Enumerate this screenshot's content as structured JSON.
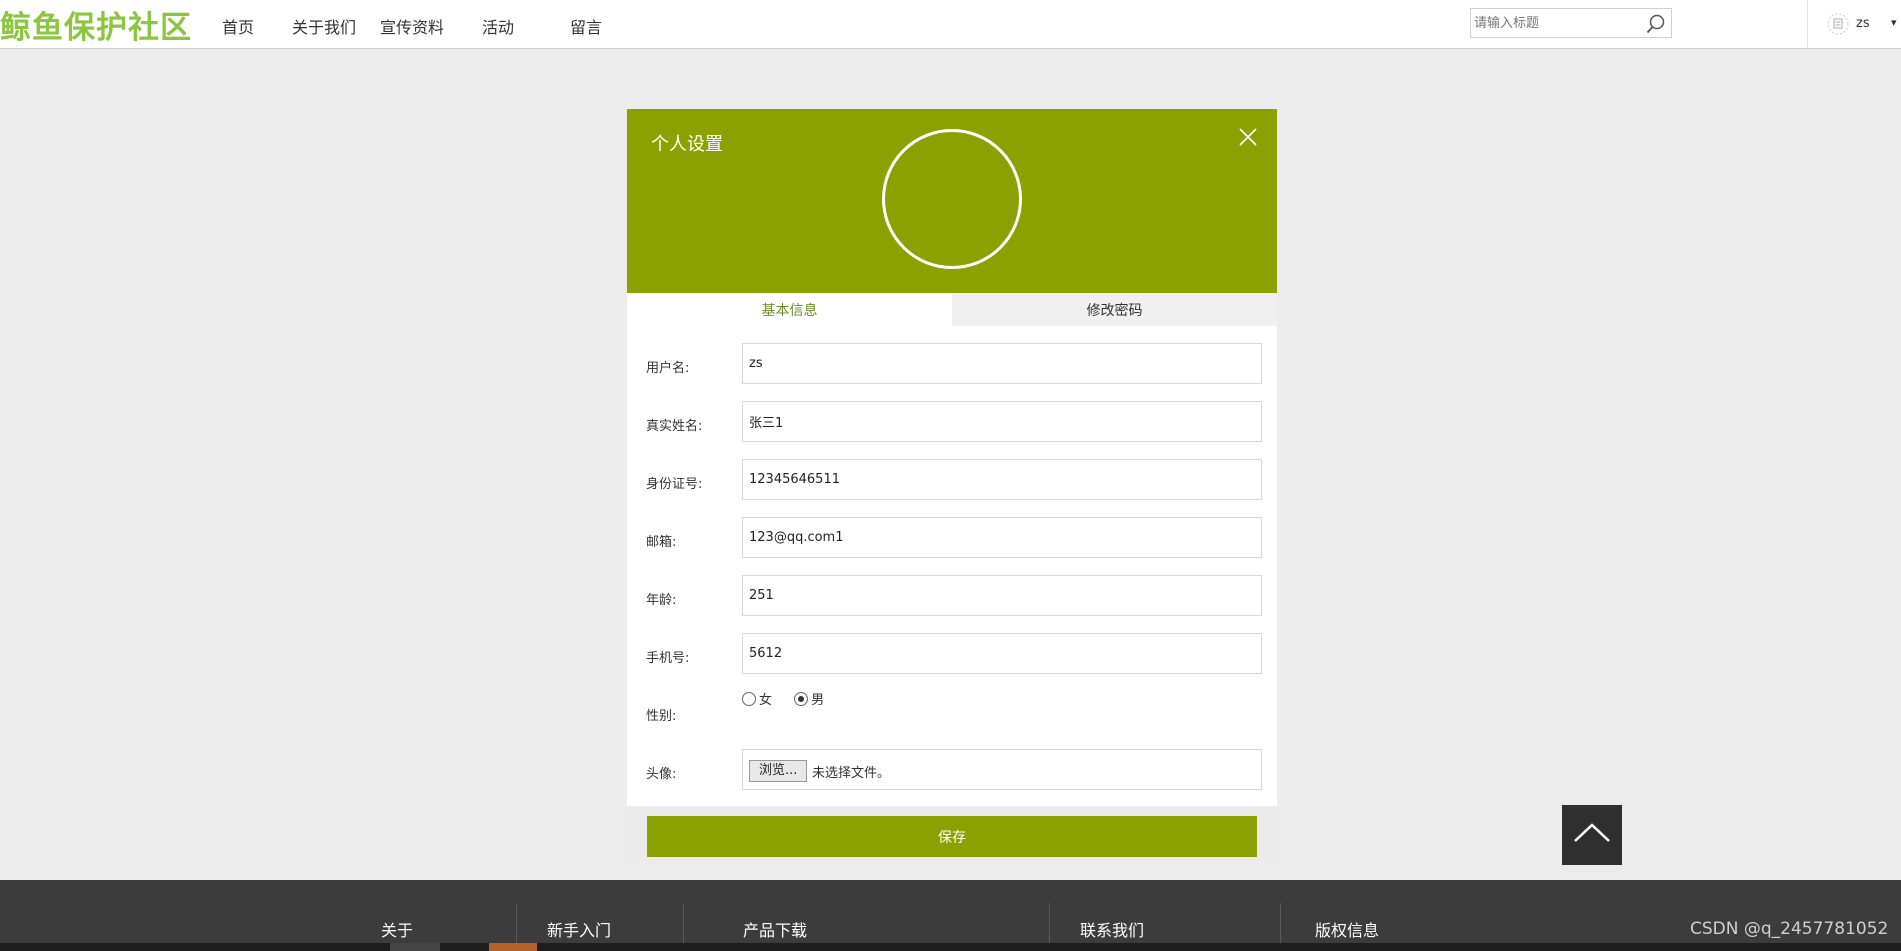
{
  "header": {
    "logo": "鲸鱼保护社区",
    "nav": [
      "首页",
      "关于我们",
      "宣传资料",
      "活动",
      "留言"
    ],
    "search_placeholder": "请输入标题",
    "username": "zs",
    "caret": "▾"
  },
  "modal": {
    "title": "个人设置",
    "tabs": [
      "基本信息",
      "修改密码"
    ],
    "fields": {
      "username": {
        "label": "用户名:",
        "value": "zs"
      },
      "realname": {
        "label": "真实姓名:",
        "value": "张三1"
      },
      "idcard": {
        "label": "身份证号:",
        "value": "12345646511"
      },
      "email": {
        "label": "邮箱:",
        "value": "123@qq.com1"
      },
      "age": {
        "label": "年龄:",
        "value": "251"
      },
      "phone": {
        "label": "手机号:",
        "value": "5612"
      }
    },
    "gender": {
      "label": "性别:",
      "options": [
        "女",
        "男"
      ],
      "selected": "男"
    },
    "avatar": {
      "label": "头像:",
      "browse": "浏览...",
      "status": "未选择文件。"
    },
    "save": "保存"
  },
  "footer": {
    "links": [
      "关于",
      "新手入门",
      "产品下载",
      "联系我们",
      "版权信息"
    ]
  },
  "watermark": "CSDN @q_2457781052",
  "colors": {
    "brand": "#8ba100",
    "logo": "#8cc63f"
  }
}
